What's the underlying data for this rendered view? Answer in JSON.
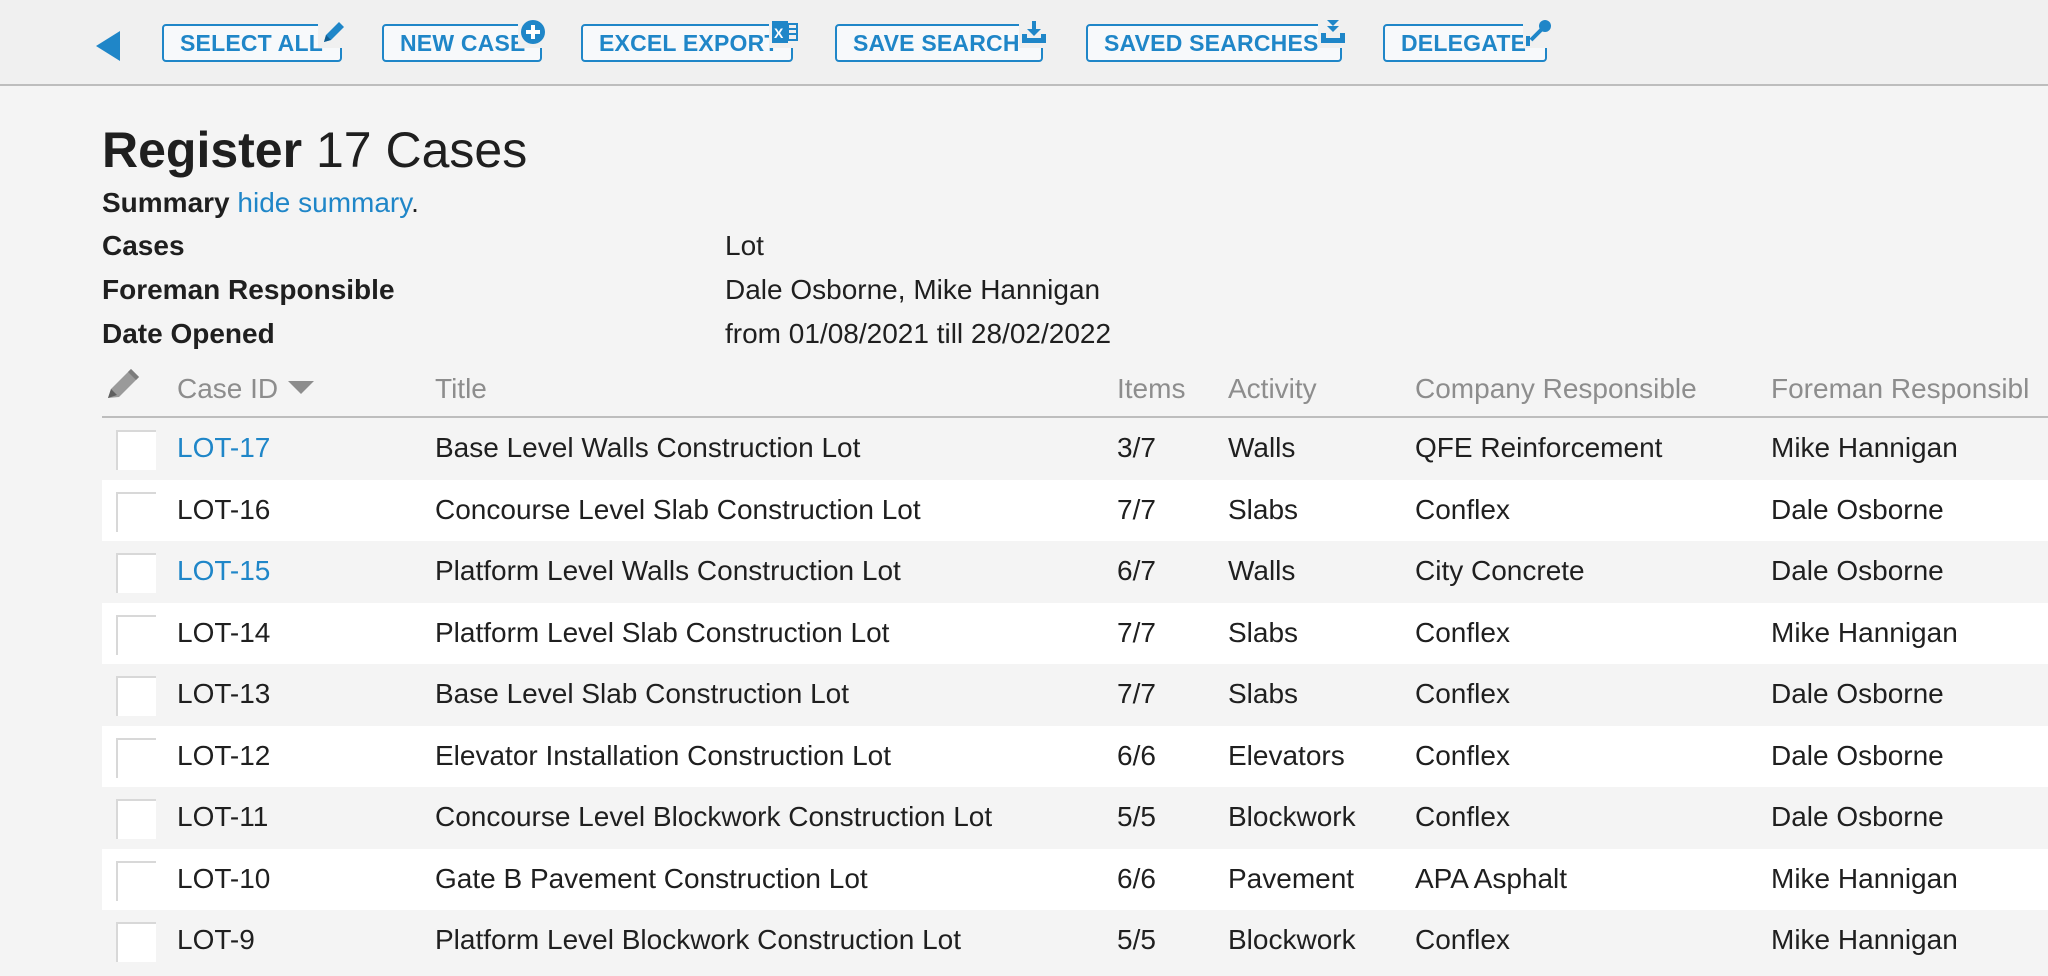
{
  "toolbar": {
    "buttons": [
      {
        "label": "SELECT ALL",
        "icon": "pencil-icon"
      },
      {
        "label": "NEW CASE",
        "icon": "plus-circle-icon"
      },
      {
        "label": "EXCEL EXPORT",
        "icon": "excel-icon"
      },
      {
        "label": "SAVE SEARCH",
        "icon": "download-tray-icon"
      },
      {
        "label": "SAVED SEARCHES",
        "icon": "stacked-download-icon"
      },
      {
        "label": "DELEGATE",
        "icon": "delegate-node-icon"
      }
    ],
    "accent": "#1f86c8"
  },
  "header": {
    "title_strong": "Register",
    "title_light": "17 Cases"
  },
  "summary": {
    "label": "Summary",
    "toggle_link": "hide summary",
    "punct": ".",
    "rows": [
      {
        "label": "Cases",
        "value": "Lot"
      },
      {
        "label": "Foreman Responsible",
        "value": "Dale Osborne, Mike Hannigan"
      },
      {
        "label": "Date Opened",
        "value": "from 01/08/2021 till 28/02/2022"
      }
    ]
  },
  "table": {
    "columns": {
      "case_id": "Case ID",
      "title": "Title",
      "items": "Items",
      "activity": "Activity",
      "company": "Company Responsible",
      "foreman": "Foreman Responsibl"
    },
    "rows": [
      {
        "id": "LOT-17",
        "title": "Base Level Walls Construction Lot",
        "items": "3/7",
        "activity": "Walls",
        "company": "QFE Reinforcement",
        "foreman": "Mike Hannigan",
        "link": true
      },
      {
        "id": "LOT-16",
        "title": "Concourse Level Slab Construction Lot",
        "items": "7/7",
        "activity": "Slabs",
        "company": "Conflex",
        "foreman": "Dale Osborne",
        "link": false
      },
      {
        "id": "LOT-15",
        "title": "Platform Level Walls Construction Lot",
        "items": "6/7",
        "activity": "Walls",
        "company": "City Concrete",
        "foreman": "Dale Osborne",
        "link": true
      },
      {
        "id": "LOT-14",
        "title": "Platform Level Slab Construction Lot",
        "items": "7/7",
        "activity": "Slabs",
        "company": "Conflex",
        "foreman": "Mike Hannigan",
        "link": false
      },
      {
        "id": "LOT-13",
        "title": "Base Level Slab Construction Lot",
        "items": "7/7",
        "activity": "Slabs",
        "company": "Conflex",
        "foreman": "Dale Osborne",
        "link": false
      },
      {
        "id": "LOT-12",
        "title": "Elevator Installation Construction Lot",
        "items": "6/6",
        "activity": "Elevators",
        "company": "Conflex",
        "foreman": "Dale Osborne",
        "link": false
      },
      {
        "id": "LOT-11",
        "title": "Concourse Level Blockwork Construction Lot",
        "items": "5/5",
        "activity": "Blockwork",
        "company": "Conflex",
        "foreman": "Dale Osborne",
        "link": false
      },
      {
        "id": "LOT-10",
        "title": "Gate B Pavement Construction Lot",
        "items": "6/6",
        "activity": "Pavement",
        "company": "APA Asphalt",
        "foreman": "Mike Hannigan",
        "link": false
      },
      {
        "id": "LOT-9",
        "title": "Platform Level Blockwork Construction Lot",
        "items": "5/5",
        "activity": "Blockwork",
        "company": "Conflex",
        "foreman": "Mike Hannigan",
        "link": false
      }
    ]
  }
}
